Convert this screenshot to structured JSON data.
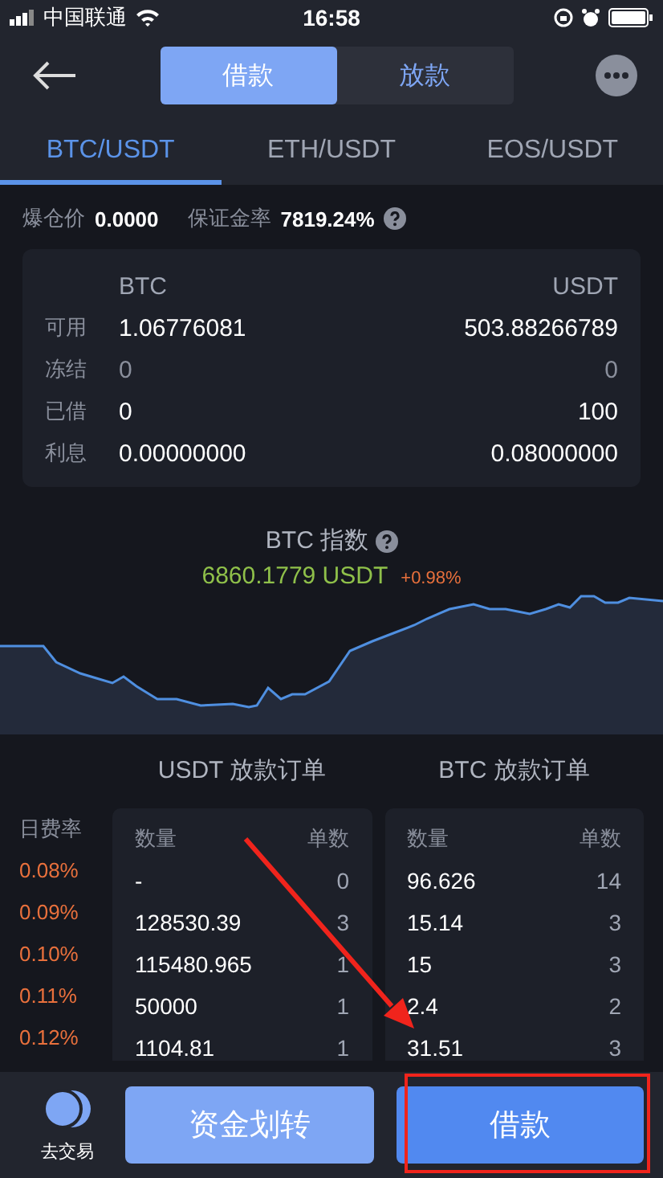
{
  "status_bar": {
    "carrier": "中国联通",
    "time": "16:58"
  },
  "header": {
    "segments": [
      {
        "label": "借款",
        "selected": true
      },
      {
        "label": "放款",
        "selected": false
      }
    ]
  },
  "pairs": [
    {
      "label": "BTC/USDT",
      "selected": true
    },
    {
      "label": "ETH/USDT",
      "selected": false
    },
    {
      "label": "EOS/USDT",
      "selected": false
    }
  ],
  "summary": [
    {
      "label": "爆仓价",
      "value": "0.0000"
    },
    {
      "label": "保证金率",
      "value": "7819.24%"
    }
  ],
  "balances": {
    "columns": [
      "BTC",
      "USDT"
    ],
    "rows": [
      {
        "label": "可用",
        "values": [
          "1.06776081",
          "503.88266789"
        ],
        "muted": false
      },
      {
        "label": "冻结",
        "values": [
          "0",
          "0"
        ],
        "muted": true
      },
      {
        "label": "已借",
        "values": [
          "0",
          "100"
        ],
        "muted": false
      },
      {
        "label": "利息",
        "values": [
          "0.00000000",
          "0.08000000"
        ],
        "muted": false
      }
    ]
  },
  "index": {
    "title": "BTC 指数",
    "price": "6860.1779 USDT",
    "change": "+0.98%"
  },
  "order_books": {
    "rate_header": "日费率",
    "rates": [
      "0.08%",
      "0.09%",
      "0.10%",
      "0.11%",
      "0.12%"
    ],
    "books": [
      {
        "title": "USDT 放款订单",
        "columns": [
          "数量",
          "单数"
        ],
        "rows": [
          [
            "-",
            "0"
          ],
          [
            "128530.39",
            "3"
          ],
          [
            "115480.965",
            "1"
          ],
          [
            "50000",
            "1"
          ],
          [
            "1104.81",
            "1"
          ]
        ]
      },
      {
        "title": "BTC 放款订单",
        "columns": [
          "数量",
          "单数"
        ],
        "rows": [
          [
            "96.626",
            "14"
          ],
          [
            "15.14",
            "3"
          ],
          [
            "15",
            "3"
          ],
          [
            "2.4",
            "2"
          ],
          [
            "31.51",
            "3"
          ]
        ]
      }
    ]
  },
  "footer": {
    "trade_label": "去交易",
    "buttons": [
      {
        "label": "资金划转",
        "kind": "secondary"
      },
      {
        "label": "借款",
        "kind": "primary"
      }
    ]
  },
  "annotations": {
    "arrow": true,
    "highlight": true
  }
}
